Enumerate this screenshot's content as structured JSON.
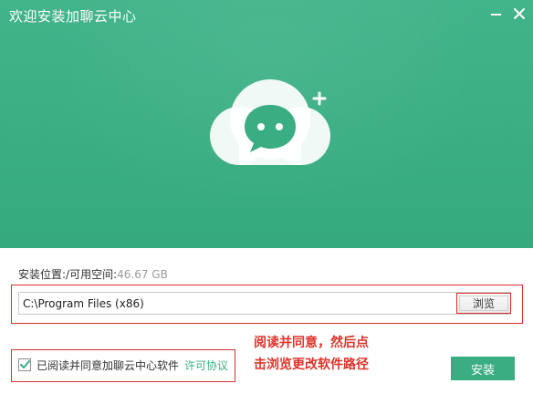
{
  "window": {
    "title": "欢迎安装加聊云中心",
    "minimize_icon": "minimize-icon",
    "close_icon": "close-icon"
  },
  "banner": {
    "logo_icon": "cloud-chat-icon",
    "plus_icon": "plus-icon",
    "colors": {
      "background": "#3aae82",
      "cloud": "#ffffff",
      "bubble": "#3aae82"
    }
  },
  "install": {
    "space_label": "安装位置:/可用空间:",
    "free_space": "46.67 GB",
    "path_value": "C:\\Program Files (x86)",
    "browse_label": "浏览"
  },
  "agreement": {
    "checked": true,
    "text": "已阅读并同意加聊云中心软件",
    "link_label": "许可协议",
    "check_icon": "check-icon"
  },
  "annotation": {
    "line1": "阅读并同意，然后点",
    "line2": "击浏览更改软件路径",
    "color": "#e0322a"
  },
  "actions": {
    "install_label": "安装",
    "accent": "#3aae82"
  }
}
